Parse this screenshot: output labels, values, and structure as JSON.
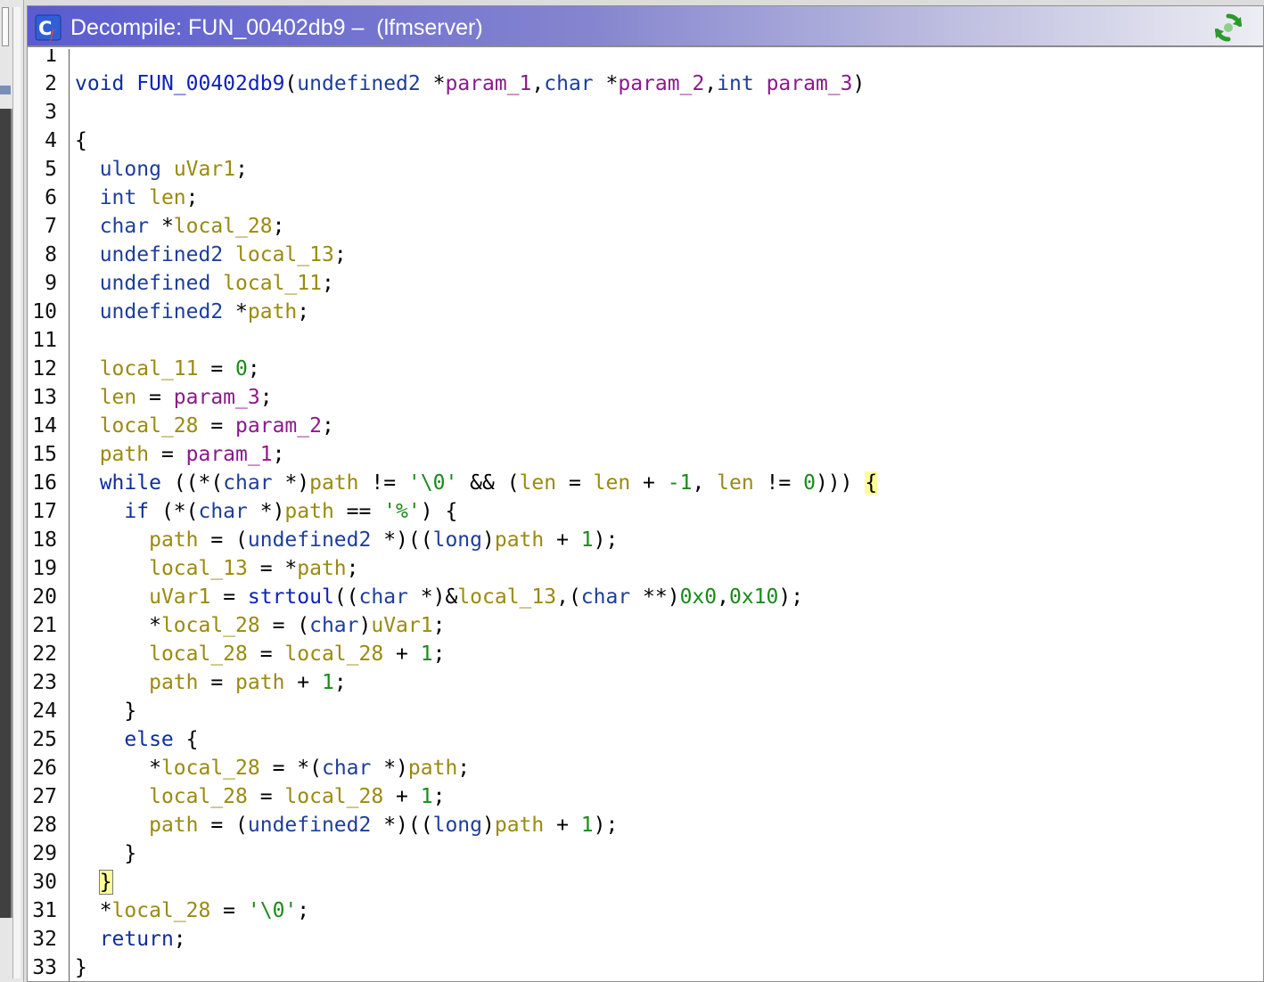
{
  "window": {
    "title": "Decompile: FUN_00402db9 –  (lfmserver)",
    "title_icon": "decompile-c-icon",
    "refresh_icon": "refresh-icon"
  },
  "colors": {
    "keyword": "#0e2e9a",
    "type": "#1d3e99",
    "function": "#0d1fbf",
    "param": "#8a1a8a",
    "local": "#9a8a10",
    "constant": "#1a8a1a",
    "brace_highlight": "#ffff9a"
  },
  "lines": [
    {
      "n": "1",
      "tokens": []
    },
    {
      "n": "2",
      "tokens": [
        [
          "kw",
          "void"
        ],
        [
          "pn",
          " "
        ],
        [
          "fn",
          "FUN_00402db9"
        ],
        [
          "pn",
          "("
        ],
        [
          "ty",
          "undefined2"
        ],
        [
          "pn",
          " *"
        ],
        [
          "pm",
          "param_1"
        ],
        [
          "pn",
          ","
        ],
        [
          "ty",
          "char"
        ],
        [
          "pn",
          " *"
        ],
        [
          "pm",
          "param_2"
        ],
        [
          "pn",
          ","
        ],
        [
          "ty",
          "int"
        ],
        [
          "pn",
          " "
        ],
        [
          "pm",
          "param_3"
        ],
        [
          "pn",
          ")"
        ]
      ]
    },
    {
      "n": "3",
      "tokens": []
    },
    {
      "n": "4",
      "tokens": [
        [
          "pn",
          "{"
        ]
      ]
    },
    {
      "n": "5",
      "tokens": [
        [
          "pn",
          "  "
        ],
        [
          "ty",
          "ulong"
        ],
        [
          "pn",
          " "
        ],
        [
          "lv",
          "uVar1"
        ],
        [
          "pn",
          ";"
        ]
      ]
    },
    {
      "n": "6",
      "tokens": [
        [
          "pn",
          "  "
        ],
        [
          "ty",
          "int"
        ],
        [
          "pn",
          " "
        ],
        [
          "lv",
          "len"
        ],
        [
          "pn",
          ";"
        ]
      ]
    },
    {
      "n": "7",
      "tokens": [
        [
          "pn",
          "  "
        ],
        [
          "ty",
          "char"
        ],
        [
          "pn",
          " *"
        ],
        [
          "lv",
          "local_28"
        ],
        [
          "pn",
          ";"
        ]
      ]
    },
    {
      "n": "8",
      "tokens": [
        [
          "pn",
          "  "
        ],
        [
          "ty",
          "undefined2"
        ],
        [
          "pn",
          " "
        ],
        [
          "lv",
          "local_13"
        ],
        [
          "pn",
          ";"
        ]
      ]
    },
    {
      "n": "9",
      "tokens": [
        [
          "pn",
          "  "
        ],
        [
          "ty",
          "undefined"
        ],
        [
          "pn",
          " "
        ],
        [
          "lv",
          "local_11"
        ],
        [
          "pn",
          ";"
        ]
      ]
    },
    {
      "n": "10",
      "tokens": [
        [
          "pn",
          "  "
        ],
        [
          "ty",
          "undefined2"
        ],
        [
          "pn",
          " *"
        ],
        [
          "lv",
          "path"
        ],
        [
          "pn",
          ";"
        ]
      ]
    },
    {
      "n": "11",
      "tokens": []
    },
    {
      "n": "12",
      "tokens": [
        [
          "pn",
          "  "
        ],
        [
          "lv",
          "local_11"
        ],
        [
          "pn",
          " = "
        ],
        [
          "num",
          "0"
        ],
        [
          "pn",
          ";"
        ]
      ]
    },
    {
      "n": "13",
      "tokens": [
        [
          "pn",
          "  "
        ],
        [
          "lv",
          "len"
        ],
        [
          "pn",
          " = "
        ],
        [
          "pm",
          "param_3"
        ],
        [
          "pn",
          ";"
        ]
      ]
    },
    {
      "n": "14",
      "tokens": [
        [
          "pn",
          "  "
        ],
        [
          "lv",
          "local_28"
        ],
        [
          "pn",
          " = "
        ],
        [
          "pm",
          "param_2"
        ],
        [
          "pn",
          ";"
        ]
      ]
    },
    {
      "n": "15",
      "tokens": [
        [
          "pn",
          "  "
        ],
        [
          "lv",
          "path"
        ],
        [
          "pn",
          " = "
        ],
        [
          "pm",
          "param_1"
        ],
        [
          "pn",
          ";"
        ]
      ]
    },
    {
      "n": "16",
      "tokens": [
        [
          "pn",
          "  "
        ],
        [
          "kw",
          "while"
        ],
        [
          "pn",
          " ((*("
        ],
        [
          "ty",
          "char"
        ],
        [
          "pn",
          " *)"
        ],
        [
          "lv",
          "path"
        ],
        [
          "pn",
          " != "
        ],
        [
          "str",
          "'\\0'"
        ],
        [
          "pn",
          " && ("
        ],
        [
          "lv",
          "len"
        ],
        [
          "pn",
          " = "
        ],
        [
          "lv",
          "len"
        ],
        [
          "pn",
          " + "
        ],
        [
          "num",
          "-1"
        ],
        [
          "pn",
          ", "
        ],
        [
          "lv",
          "len"
        ],
        [
          "pn",
          " != "
        ],
        [
          "num",
          "0"
        ],
        [
          "pn",
          ")))"
        ],
        [
          "pn",
          " "
        ],
        [
          "hl",
          "{"
        ]
      ]
    },
    {
      "n": "17",
      "tokens": [
        [
          "pn",
          "    "
        ],
        [
          "kw",
          "if"
        ],
        [
          "pn",
          " (*("
        ],
        [
          "ty",
          "char"
        ],
        [
          "pn",
          " *)"
        ],
        [
          "lv",
          "path"
        ],
        [
          "pn",
          " == "
        ],
        [
          "str",
          "'%'"
        ],
        [
          "pn",
          ") {"
        ]
      ]
    },
    {
      "n": "18",
      "tokens": [
        [
          "pn",
          "      "
        ],
        [
          "lv",
          "path"
        ],
        [
          "pn",
          " = ("
        ],
        [
          "ty",
          "undefined2"
        ],
        [
          "pn",
          " *)(("
        ],
        [
          "ty",
          "long"
        ],
        [
          "pn",
          ")"
        ],
        [
          "lv",
          "path"
        ],
        [
          "pn",
          " + "
        ],
        [
          "num",
          "1"
        ],
        [
          "pn",
          ");"
        ]
      ]
    },
    {
      "n": "19",
      "tokens": [
        [
          "pn",
          "      "
        ],
        [
          "lv",
          "local_13"
        ],
        [
          "pn",
          " = *"
        ],
        [
          "lv",
          "path"
        ],
        [
          "pn",
          ";"
        ]
      ]
    },
    {
      "n": "20",
      "tokens": [
        [
          "pn",
          "      "
        ],
        [
          "lv",
          "uVar1"
        ],
        [
          "pn",
          " = "
        ],
        [
          "fn",
          "strtoul"
        ],
        [
          "pn",
          "(("
        ],
        [
          "ty",
          "char"
        ],
        [
          "pn",
          " *)&"
        ],
        [
          "lv",
          "local_13"
        ],
        [
          "pn",
          ",("
        ],
        [
          "ty",
          "char"
        ],
        [
          "pn",
          " **)"
        ],
        [
          "num",
          "0x0"
        ],
        [
          "pn",
          ","
        ],
        [
          "num",
          "0x10"
        ],
        [
          "pn",
          ");"
        ]
      ]
    },
    {
      "n": "21",
      "tokens": [
        [
          "pn",
          "      *"
        ],
        [
          "lv",
          "local_28"
        ],
        [
          "pn",
          " = ("
        ],
        [
          "ty",
          "char"
        ],
        [
          "pn",
          ")"
        ],
        [
          "lv",
          "uVar1"
        ],
        [
          "pn",
          ";"
        ]
      ]
    },
    {
      "n": "22",
      "tokens": [
        [
          "pn",
          "      "
        ],
        [
          "lv",
          "local_28"
        ],
        [
          "pn",
          " = "
        ],
        [
          "lv",
          "local_28"
        ],
        [
          "pn",
          " + "
        ],
        [
          "num",
          "1"
        ],
        [
          "pn",
          ";"
        ]
      ]
    },
    {
      "n": "23",
      "tokens": [
        [
          "pn",
          "      "
        ],
        [
          "lv",
          "path"
        ],
        [
          "pn",
          " = "
        ],
        [
          "lv",
          "path"
        ],
        [
          "pn",
          " + "
        ],
        [
          "num",
          "1"
        ],
        [
          "pn",
          ";"
        ]
      ]
    },
    {
      "n": "24",
      "tokens": [
        [
          "pn",
          "    }"
        ]
      ]
    },
    {
      "n": "25",
      "tokens": [
        [
          "pn",
          "    "
        ],
        [
          "kw",
          "else"
        ],
        [
          "pn",
          " {"
        ]
      ]
    },
    {
      "n": "26",
      "tokens": [
        [
          "pn",
          "      *"
        ],
        [
          "lv",
          "local_28"
        ],
        [
          "pn",
          " = *("
        ],
        [
          "ty",
          "char"
        ],
        [
          "pn",
          " *)"
        ],
        [
          "lv",
          "path"
        ],
        [
          "pn",
          ";"
        ]
      ]
    },
    {
      "n": "27",
      "tokens": [
        [
          "pn",
          "      "
        ],
        [
          "lv",
          "local_28"
        ],
        [
          "pn",
          " = "
        ],
        [
          "lv",
          "local_28"
        ],
        [
          "pn",
          " + "
        ],
        [
          "num",
          "1"
        ],
        [
          "pn",
          ";"
        ]
      ]
    },
    {
      "n": "28",
      "tokens": [
        [
          "pn",
          "      "
        ],
        [
          "lv",
          "path"
        ],
        [
          "pn",
          " = ("
        ],
        [
          "ty",
          "undefined2"
        ],
        [
          "pn",
          " *)(("
        ],
        [
          "ty",
          "long"
        ],
        [
          "pn",
          ")"
        ],
        [
          "lv",
          "path"
        ],
        [
          "pn",
          " + "
        ],
        [
          "num",
          "1"
        ],
        [
          "pn",
          ");"
        ]
      ]
    },
    {
      "n": "29",
      "tokens": [
        [
          "pn",
          "    }"
        ]
      ]
    },
    {
      "n": "30",
      "tokens": [
        [
          "pn",
          "  "
        ],
        [
          "hlb",
          "}"
        ]
      ]
    },
    {
      "n": "31",
      "tokens": [
        [
          "pn",
          "  *"
        ],
        [
          "lv",
          "local_28"
        ],
        [
          "pn",
          " = "
        ],
        [
          "str",
          "'\\0'"
        ],
        [
          "pn",
          ";"
        ]
      ]
    },
    {
      "n": "32",
      "tokens": [
        [
          "pn",
          "  "
        ],
        [
          "kw",
          "return"
        ],
        [
          "pn",
          ";"
        ]
      ]
    },
    {
      "n": "33",
      "tokens": [
        [
          "pn",
          "}"
        ]
      ]
    }
  ]
}
